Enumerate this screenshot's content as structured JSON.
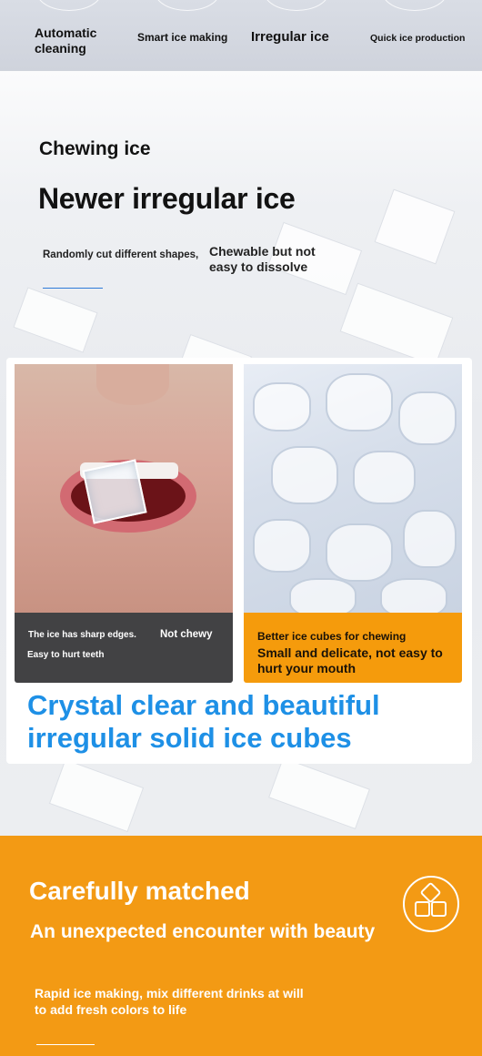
{
  "top_features": {
    "f1": "Automatic cleaning",
    "f2": "Smart ice making",
    "f3": "Irregular ice",
    "f4": "Quick ice production"
  },
  "hero": {
    "subtitle": "Chewing ice",
    "title": "Newer irregular ice",
    "point1": "Randomly cut different shapes,",
    "point2": "Chewable but not easy to dissolve"
  },
  "compare": {
    "left_line1": "The ice has sharp edges.",
    "left_line2": "Not chewy",
    "left_line3": "Easy to hurt teeth",
    "right_line1": "Better ice cubes for chewing",
    "right_line2": "Small and delicate, not easy to hurt your mouth",
    "headline": "Crystal clear and beautiful irregular solid ice cubes"
  },
  "matched": {
    "title": "Carefully matched",
    "subtitle": "An unexpected encounter with beauty",
    "description": "Rapid ice making, mix different drinks at will to add fresh colors to life",
    "icon": "ice-cubes-icon"
  },
  "colors": {
    "accent_orange": "#f39a14",
    "headline_blue": "#1e90e6",
    "dark_band": "#424244"
  }
}
